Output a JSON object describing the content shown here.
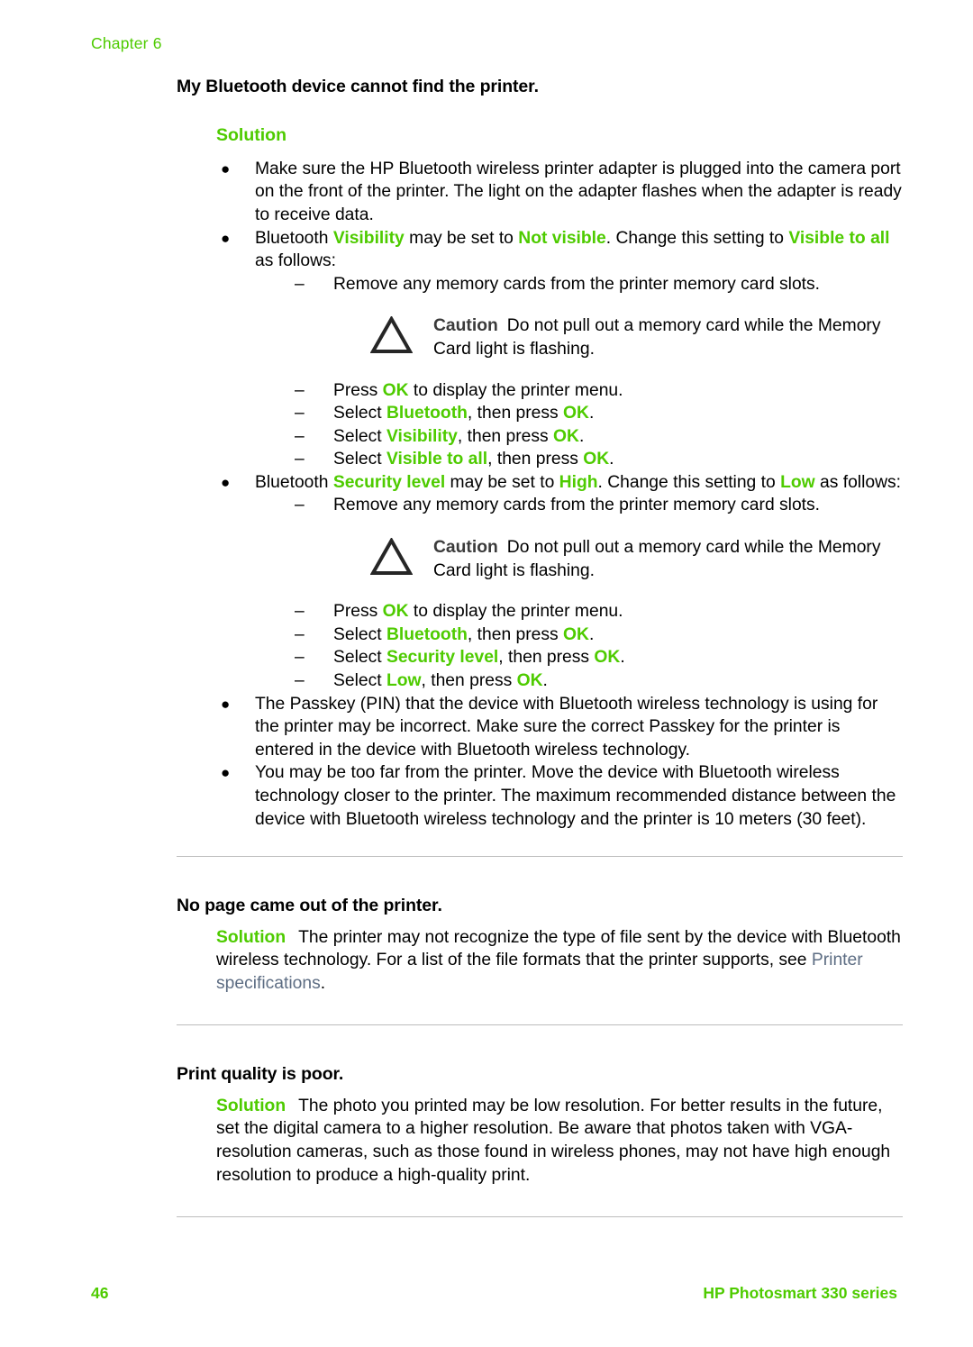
{
  "page": {
    "chapter_label": "Chapter 6",
    "folio": "46",
    "book_title": "HP Photosmart 330 series",
    "accent_green": "#4ecb00",
    "link_color": "#5d6d83",
    "caution_label_color": "#3b3b3b",
    "rule_color": "#bcbcbc"
  },
  "section1": {
    "heading": "My Bluetooth device cannot find the printer.",
    "solution_label": "Solution",
    "bullets": {
      "b1": {
        "marker": "●",
        "text": "Make sure the HP Bluetooth wireless printer adapter is plugged into the camera port on the front of the printer. The light on the adapter flashes when the adapter is ready to receive data."
      },
      "b2": {
        "marker": "●",
        "lead": "Bluetooth ",
        "term1": "Visibility",
        "mid1": " may be set to ",
        "term2": "Not visible",
        "mid2": ". Change this setting to ",
        "term3": "Visible to all",
        "tail": " as follows:",
        "steps": {
          "s1": {
            "marker": "–",
            "text": "Remove any memory cards from the printer memory card slots."
          },
          "caution": {
            "icon": "caution-triangle-icon",
            "label": "Caution",
            "text": "Do not pull out a memory card while the Memory Card light is flashing."
          },
          "s2": {
            "marker": "–",
            "pre": "Press ",
            "key": "OK",
            "post": " to display the printer menu."
          },
          "s3": {
            "marker": "–",
            "pre": "Select ",
            "item": "Bluetooth",
            "mid": ", then press ",
            "key": "OK",
            "post": "."
          },
          "s4": {
            "marker": "–",
            "pre": "Select ",
            "item": "Visibility",
            "mid": ", then press ",
            "key": "OK",
            "post": "."
          },
          "s5": {
            "marker": "–",
            "pre": "Select ",
            "item": "Visible to all",
            "mid": ", then press ",
            "key": "OK",
            "post": "."
          }
        }
      },
      "b3": {
        "marker": "●",
        "lead": "Bluetooth ",
        "term1": "Security level",
        "mid1": " may be set to ",
        "term2": "High",
        "mid2": ". Change this setting to ",
        "term3": "Low",
        "tail": " as follows:",
        "steps": {
          "s1": {
            "marker": "–",
            "text": "Remove any memory cards from the printer memory card slots."
          },
          "caution": {
            "icon": "caution-triangle-icon",
            "label": "Caution",
            "text": "Do not pull out a memory card while the Memory Card light is flashing."
          },
          "s2": {
            "marker": "–",
            "pre": "Press ",
            "key": "OK",
            "post": " to display the printer menu."
          },
          "s3": {
            "marker": "–",
            "pre": "Select ",
            "item": "Bluetooth",
            "mid": ", then press ",
            "key": "OK",
            "post": "."
          },
          "s4": {
            "marker": "–",
            "pre": "Select ",
            "item": "Security level",
            "mid": ", then press ",
            "key": "OK",
            "post": "."
          },
          "s5": {
            "marker": "–",
            "pre": "Select ",
            "item": "Low",
            "mid": ", then press ",
            "key": "OK",
            "post": "."
          }
        }
      },
      "b4": {
        "marker": "●",
        "text": "The Passkey (PIN) that the device with Bluetooth wireless technology is using for the printer may be incorrect. Make sure the correct Passkey for the printer is entered in the device with Bluetooth wireless technology."
      },
      "b5": {
        "marker": "●",
        "text": "You may be too far from the printer. Move the device with Bluetooth wireless technology closer to the printer. The maximum recommended distance between the device with Bluetooth wireless technology and the printer is 10 meters (30 feet)."
      }
    }
  },
  "section2": {
    "heading": "No page came out of the printer.",
    "solution_label": "Solution",
    "body_pre": "The printer may not recognize the type of file sent by the device with Bluetooth wireless technology. For a list of the file formats that the printer supports, see ",
    "link_text": "Printer specifications",
    "body_post": "."
  },
  "section3": {
    "heading": "Print quality is poor.",
    "solution_label": "Solution",
    "body": "The photo you printed may be low resolution. For better results in the future, set the digital camera to a higher resolution. Be aware that photos taken with VGA-resolution cameras, such as those found in wireless phones, may not have high enough resolution to produce a high-quality print."
  }
}
